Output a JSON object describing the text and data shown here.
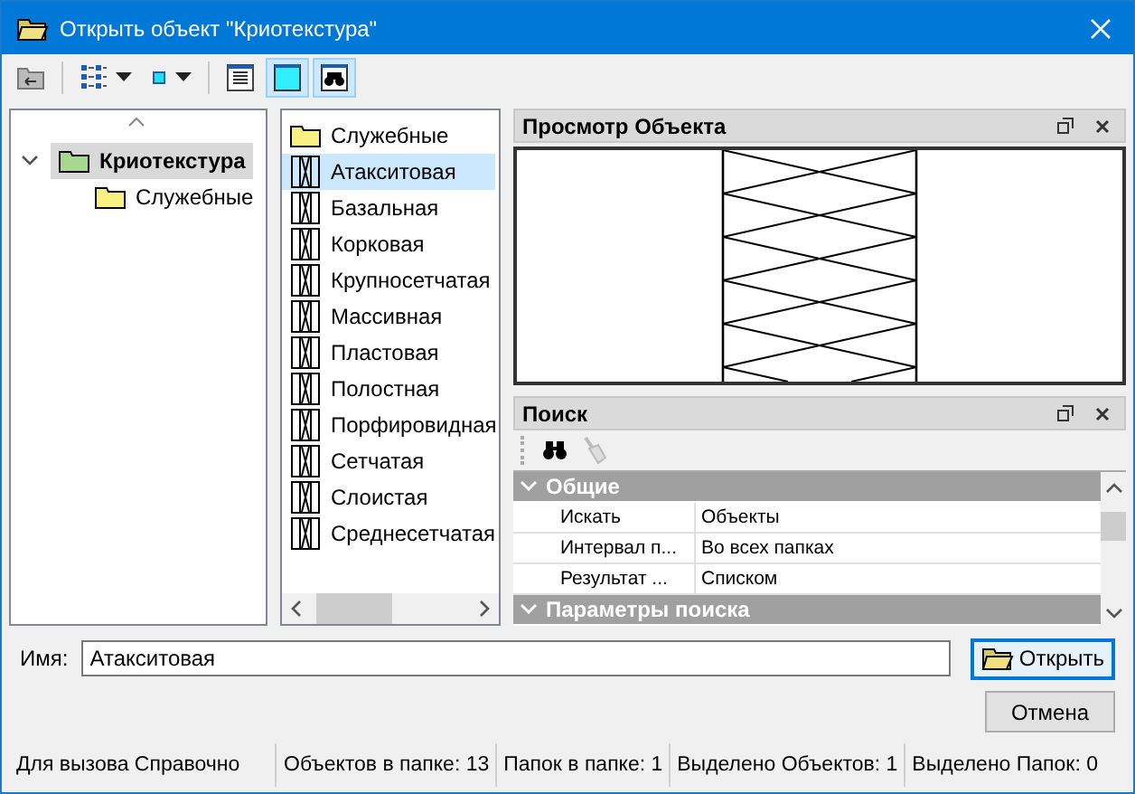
{
  "window": {
    "title": "Открыть объект \"Криотекстура\""
  },
  "toolbar": [
    {
      "kind": "up",
      "selected": false
    },
    {
      "kind": "view-menu",
      "selected": false
    },
    {
      "kind": "marker-menu",
      "selected": false
    },
    {
      "kind": "document",
      "selected": false
    },
    {
      "kind": "preview",
      "selected": true
    },
    {
      "kind": "search",
      "selected": true
    }
  ],
  "tree": {
    "items": [
      {
        "label": "Криотекстура",
        "expanded": true,
        "selected": true,
        "children": [
          {
            "label": "Служебные",
            "selected": false
          }
        ]
      }
    ]
  },
  "list": {
    "items": [
      {
        "label": "Служебные",
        "kind": "folder",
        "selected": false
      },
      {
        "label": "Атакситовая",
        "kind": "texture",
        "selected": true
      },
      {
        "label": "Базальная",
        "kind": "texture",
        "selected": false
      },
      {
        "label": "Корковая",
        "kind": "texture",
        "selected": false
      },
      {
        "label": "Крупносетчатая",
        "kind": "texture",
        "selected": false
      },
      {
        "label": "Массивная",
        "kind": "texture",
        "selected": false
      },
      {
        "label": "Пластовая",
        "kind": "texture",
        "selected": false
      },
      {
        "label": "Полостная",
        "kind": "texture",
        "selected": false
      },
      {
        "label": "Порфировидная",
        "kind": "texture",
        "selected": false
      },
      {
        "label": "Сетчатая",
        "kind": "texture",
        "selected": false
      },
      {
        "label": "Слоистая",
        "kind": "texture",
        "selected": false
      },
      {
        "label": "Среднесетчатая",
        "kind": "texture",
        "selected": false
      }
    ]
  },
  "preview_panel": {
    "title": "Просмотр Объекта"
  },
  "search_panel": {
    "title": "Поиск",
    "groups": [
      {
        "label": "Общие",
        "expanded": true,
        "rows": [
          {
            "name": "Искать",
            "value": "Объекты"
          },
          {
            "name": "Интервал п...",
            "value": "Во всех папках"
          },
          {
            "name": "Результат ...",
            "value": "Списком"
          }
        ]
      },
      {
        "label": "Параметры поиска",
        "expanded": true
      }
    ]
  },
  "name_field": {
    "label": "Имя:",
    "value": "Атакситовая"
  },
  "buttons": {
    "open": "Открыть",
    "cancel": "Отмена"
  },
  "status_bar": [
    "Для вызова Справочно",
    "Объектов в папке: 13",
    "Папок в папке: 1",
    "Выделено Объектов: 1",
    "Выделено Папок: 0"
  ]
}
